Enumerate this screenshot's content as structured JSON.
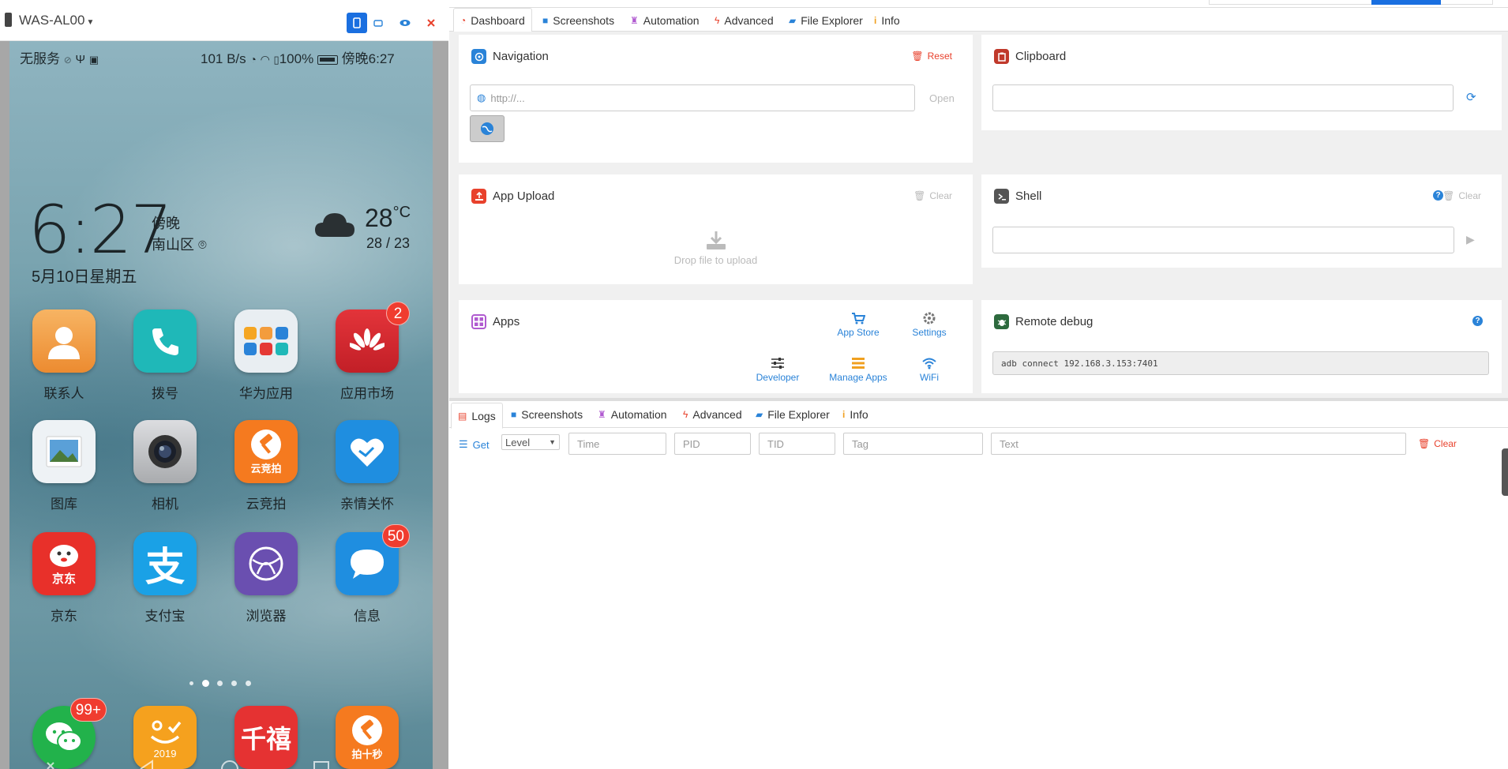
{
  "device": {
    "name": "WAS-AL00",
    "status": {
      "carrier": "无服务",
      "speed": "101 B/s",
      "battery": "100%",
      "time": "傍晚6:27"
    },
    "clock": {
      "time": "6:27",
      "period": "傍晚",
      "location": "南山区",
      "date": "5月10日星期五"
    },
    "weather": {
      "temp": "28",
      "unit": "°C",
      "range": "28 / 23"
    },
    "apps_row1": [
      {
        "label": "联系人",
        "color": "#f3a04a"
      },
      {
        "label": "拨号",
        "color": "#1fb8b8"
      },
      {
        "label": "华为应用",
        "color": "#e9eef2"
      },
      {
        "label": "应用市场",
        "color": "#d8282f",
        "badge": "2"
      }
    ],
    "apps_row2": [
      {
        "label": "图库",
        "color": "#eef2f5"
      },
      {
        "label": "相机",
        "color": "#c9cbce"
      },
      {
        "label": "云竞拍",
        "color": "#f57a1f"
      },
      {
        "label": "亲情关怀",
        "color": "#1f8ee0"
      }
    ],
    "apps_row3": [
      {
        "label": "京东",
        "color": "#e8302a"
      },
      {
        "label": "支付宝",
        "color": "#1aa1e6"
      },
      {
        "label": "浏览器",
        "color": "#6a4fb0"
      },
      {
        "label": "信息",
        "color": "#1f8ee0",
        "badge": "50"
      }
    ],
    "dock": [
      {
        "label": "wechat",
        "color": "#22b24b",
        "badge": "99+"
      },
      {
        "label": "2019",
        "color": "#f5a11e"
      },
      {
        "label": "千禧",
        "color": "#e53232"
      },
      {
        "label": "拍十秒",
        "color": "#f57a1f"
      }
    ]
  },
  "top_tabs": [
    "Dashboard",
    "Screenshots",
    "Automation",
    "Advanced",
    "File Explorer",
    "Info"
  ],
  "bottom_tabs": [
    "Logs",
    "Screenshots",
    "Automation",
    "Advanced",
    "File Explorer",
    "Info"
  ],
  "navigation": {
    "title": "Navigation",
    "reset": "Reset",
    "placeholder": "http://...",
    "open": "Open"
  },
  "clipboard": {
    "title": "Clipboard"
  },
  "app_upload": {
    "title": "App Upload",
    "clear": "Clear",
    "drop": "Drop file to upload"
  },
  "shell": {
    "title": "Shell",
    "clear": "Clear"
  },
  "apps": {
    "title": "Apps",
    "links": [
      "App Store",
      "Settings",
      "Developer",
      "Manage Apps",
      "WiFi"
    ]
  },
  "remote_debug": {
    "title": "Remote debug",
    "command": "adb connect 192.168.3.153:7401"
  },
  "logs": {
    "get": "Get",
    "level": "Level",
    "filters": [
      "Time",
      "PID",
      "TID",
      "Tag",
      "Text"
    ],
    "clear": "Clear"
  },
  "colors": {
    "accent": "#2a83d8",
    "danger": "#e8412c",
    "primary_btn": "#1a6fe0"
  }
}
